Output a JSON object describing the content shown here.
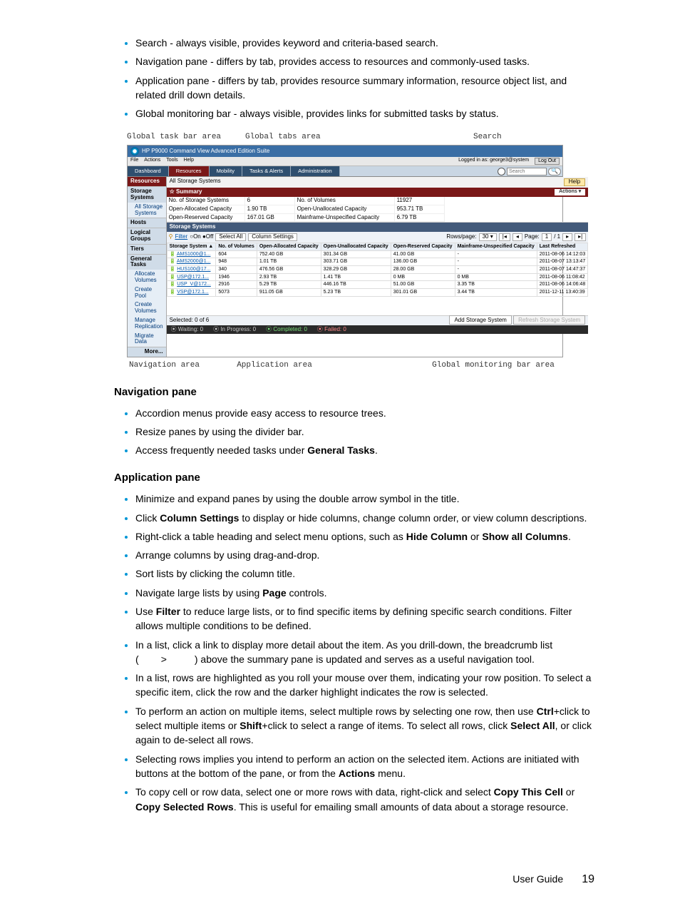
{
  "top_bullets": [
    "Search - always visible, provides keyword and criteria-based search.",
    "Navigation pane - differs by tab, provides access to resources and commonly-used tasks.",
    "Application pane - differs by tab, provides resource summary information, resource object list, and related drill down details.",
    "Global monitoring bar - always visible, provides links for submitted tasks by status."
  ],
  "shot_labels_top": [
    "Global task bar area",
    "Global tabs area",
    "Search"
  ],
  "shot_labels_bot": [
    "Navigation area",
    "Application area",
    "Global monitoring bar area"
  ],
  "screenshot": {
    "title": "HP P9000 Command View Advanced Edition Suite",
    "menu": [
      "File",
      "Actions",
      "Tools",
      "Help"
    ],
    "logged_in": "Logged in as: george3@system",
    "logout": "Log Out",
    "tabs": [
      "Dashboard",
      "Resources",
      "Mobility",
      "Tasks & Alerts",
      "Administration"
    ],
    "active_tab": 1,
    "search_placeholder": "Search",
    "nav": {
      "header": "Resources",
      "groups": [
        {
          "title": "Storage Systems",
          "items": [
            "All Storage Systems"
          ]
        },
        {
          "title": "Hosts",
          "items": []
        },
        {
          "title": "Logical Groups",
          "items": []
        },
        {
          "title": "Tiers",
          "items": []
        },
        {
          "title": "General Tasks",
          "items": [
            "Allocate Volumes",
            "Create Pool",
            "Create Volumes",
            "Manage Replication",
            "Migrate Data"
          ]
        }
      ],
      "more": "More..."
    },
    "breadcrumb": "All Storage Systems",
    "help": "Help",
    "summary_title": "Summary",
    "actions_btn": "Actions ▾",
    "summary": [
      [
        "No. of Storage Systems",
        "6",
        "No. of Volumes",
        "11927"
      ],
      [
        "Open-Allocated Capacity",
        "1.90 TB",
        "Open-Unallocated Capacity",
        "953.71 TB"
      ],
      [
        "Open-Reserved Capacity",
        "167.01 GB",
        "Mainframe-Unspecified Capacity",
        "6.79 TB"
      ]
    ],
    "section_title": "Storage Systems",
    "toolbar": {
      "filter_label": "Filter",
      "on": "On",
      "off": "Off",
      "select_all": "Select All",
      "column_settings": "Column Settings",
      "rows_label": "Rows/page:",
      "rows_value": "30",
      "page_label": "Page:",
      "page_value": "1",
      "page_total": "/ 1"
    },
    "columns": [
      "Storage System ▲",
      "No. of Volumes",
      "Open-Allocated Capacity",
      "Open-Unallocated Capacity",
      "Open-Reserved Capacity",
      "Mainframe-Unspecified Capacity",
      "Last Refreshed"
    ],
    "rows": [
      [
        "AMS1000@1...",
        "604",
        "752.40 GB",
        "301.34 GB",
        "41.00 GB",
        "-",
        "2011-08-06 14:12:03"
      ],
      [
        "AMS2000@1...",
        "948",
        "1.01 TB",
        "303.71 GB",
        "136.00 GB",
        "-",
        "2011-08-07 13:13:47"
      ],
      [
        "HUS100@17...",
        "340",
        "476.56 GB",
        "328.29 GB",
        "28.00 GB",
        "-",
        "2011-08-07 14:47:37"
      ],
      [
        "USP@172.1...",
        "1946",
        "2.93 TB",
        "1.41 TB",
        "0 MB",
        "0 MB",
        "2011-08-06 11:08:42"
      ],
      [
        "USP_V@172...",
        "2916",
        "5.29 TB",
        "446.16 TB",
        "51.00 GB",
        "3.35 TB",
        "2011-08-06 14:06:48"
      ],
      [
        "VSP@172.1...",
        "5073",
        "911.05 GB",
        "5.23 TB",
        "301.01 GB",
        "3.44 TB",
        "2011-12-11 13:40:39"
      ]
    ],
    "selected": "Selected: 0 of 6",
    "add_btn": "Add Storage System",
    "refresh_btn": "Refresh Storage System",
    "monitor": [
      "Waiting: 0",
      "In Progress: 0",
      "Completed: 0",
      "Failed: 0"
    ]
  },
  "nav_section_title": "Navigation pane",
  "nav_bullets": [
    {
      "pre": "Accordion menus provide easy access to resource trees.",
      "b": "",
      "post": ""
    },
    {
      "pre": "Resize panes by using the divider bar.",
      "b": "",
      "post": ""
    },
    {
      "pre": "Access frequently needed tasks under ",
      "b": "General Tasks",
      "post": "."
    }
  ],
  "app_section_title": "Application pane",
  "app_bullets": [
    {
      "parts": [
        {
          "t": "Minimize and expand panes by using the double arrow symbol in the title."
        }
      ]
    },
    {
      "parts": [
        {
          "t": "Click "
        },
        {
          "b": "Column Settings"
        },
        {
          "t": " to display or hide columns, change column order, or view column descriptions."
        }
      ]
    },
    {
      "parts": [
        {
          "t": "Right-click a table heading and select menu options, such as "
        },
        {
          "b": "Hide Column"
        },
        {
          "t": " or "
        },
        {
          "b": "Show all Columns"
        },
        {
          "t": "."
        }
      ]
    },
    {
      "parts": [
        {
          "t": "Arrange columns by using drag-and-drop."
        }
      ]
    },
    {
      "parts": [
        {
          "t": "Sort lists by clicking the column title."
        }
      ]
    },
    {
      "parts": [
        {
          "t": "Navigate large lists by using "
        },
        {
          "b": "Page"
        },
        {
          "t": " controls."
        }
      ]
    },
    {
      "parts": [
        {
          "t": "Use "
        },
        {
          "b": "Filter"
        },
        {
          "t": " to reduce large lists, or to find specific items by defining specific search conditions. Filter allows multiple conditions to be defined."
        }
      ]
    },
    {
      "parts": [
        {
          "t": "In a list, click a link to display more detail about the item. As you drill-down, the breadcrumb list (        >          ) above the summary pane is updated and serves as a useful navigation tool."
        }
      ]
    },
    {
      "parts": [
        {
          "t": "In a list, rows are highlighted as you roll your mouse over them, indicating your row position. To select a specific item, click the row and the darker highlight indicates the row is selected."
        }
      ]
    },
    {
      "parts": [
        {
          "t": "To perform an action on multiple items, select multiple rows by selecting one row, then use "
        },
        {
          "b": "Ctrl"
        },
        {
          "t": "+click to select multiple items or "
        },
        {
          "b": "Shift"
        },
        {
          "t": "+click to select a range of items. To select all rows, click "
        },
        {
          "b": "Select All"
        },
        {
          "t": ", or click again to de-select all rows."
        }
      ]
    },
    {
      "parts": [
        {
          "t": "Selecting rows implies you intend to perform an action on the selected item. Actions are initiated with buttons at the bottom of the pane, or from the "
        },
        {
          "b": "Actions"
        },
        {
          "t": " menu."
        }
      ]
    },
    {
      "parts": [
        {
          "t": "To copy cell or row data, select one or more rows with data, right-click and select "
        },
        {
          "b": "Copy This Cell"
        },
        {
          "t": " or "
        },
        {
          "b": "Copy Selected Rows"
        },
        {
          "t": ". This is useful for emailing small amounts of data about a storage resource."
        }
      ]
    }
  ],
  "footer_label": "User Guide",
  "footer_page": "19"
}
